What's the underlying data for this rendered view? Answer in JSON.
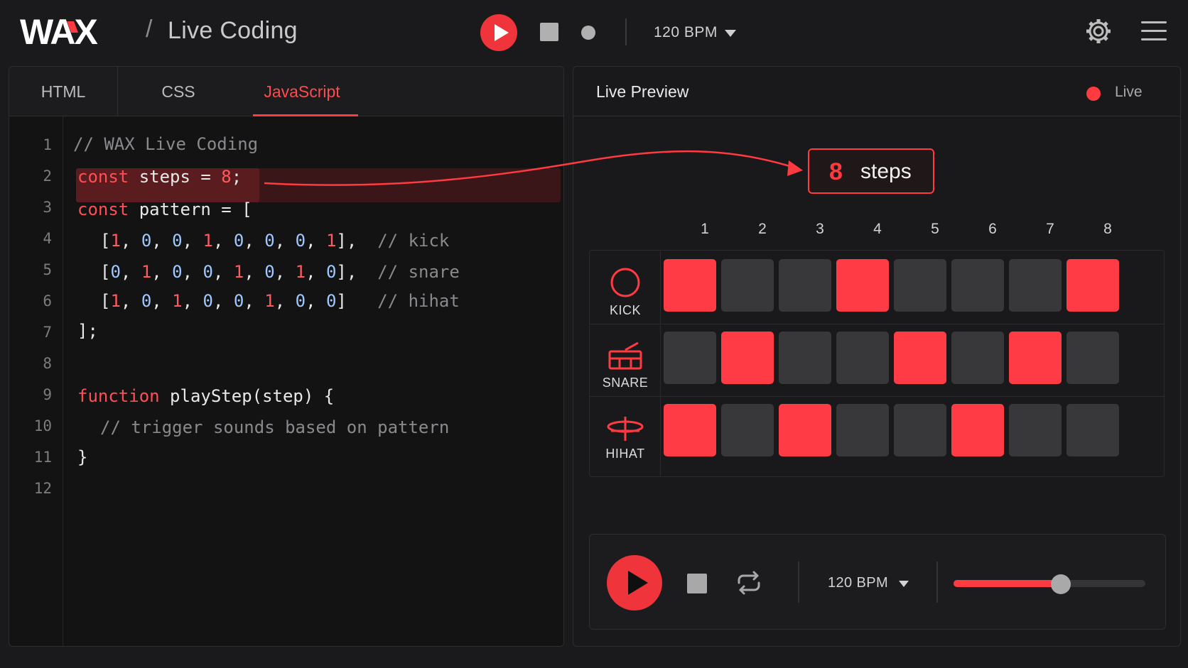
{
  "app": {
    "logo_text": "WAX",
    "separator": "/",
    "title": "Live Coding"
  },
  "toolbar": {
    "bpm": "120 BPM"
  },
  "editor": {
    "tabs": [
      {
        "label": "HTML",
        "active": false
      },
      {
        "label": "CSS",
        "active": false
      },
      {
        "label": "JavaScript",
        "active": true
      }
    ],
    "line_numbers": [
      "1",
      "2",
      "3",
      "4",
      "5",
      "6",
      "7",
      "8",
      "9",
      "10",
      "11",
      "12"
    ],
    "highlighted_line": 2,
    "lines": {
      "l1": "// WAX Live Coding",
      "l2_kw": "const",
      "l2_rest": " steps = ",
      "l2_num": "8",
      "l2_end": ";",
      "l3_kw": "const",
      "l3_rest": " pattern = [",
      "l4_comment": "// kick",
      "l5_comment": "// snare",
      "l6_comment": "// hihat",
      "l7": "];",
      "l9_kw": "function",
      "l9_rest": " playStep(step) {",
      "l10": "// trigger sounds based on pattern",
      "l11": "}"
    }
  },
  "preview": {
    "title": "Live Preview",
    "live_label": "Live",
    "steps_badge": {
      "value": "8",
      "label": "steps"
    },
    "columns": [
      "1",
      "2",
      "3",
      "4",
      "5",
      "6",
      "7",
      "8"
    ],
    "instruments": [
      {
        "name": "KICK",
        "icon": "kick-drum-icon",
        "pattern": [
          1,
          0,
          0,
          1,
          0,
          0,
          0,
          1
        ]
      },
      {
        "name": "SNARE",
        "icon": "snare-drum-icon",
        "pattern": [
          0,
          1,
          0,
          0,
          1,
          0,
          1,
          0
        ]
      },
      {
        "name": "HIHAT",
        "icon": "hihat-cymbal-icon",
        "pattern": [
          1,
          0,
          1,
          0,
          0,
          1,
          0,
          0
        ]
      }
    ],
    "transport": {
      "bpm": "120 BPM",
      "volume": 0.56
    }
  },
  "colors": {
    "accent": "#ff3b41",
    "step_on": "#ff3b45",
    "step_off": "#38383b",
    "background": "#1a1a1c"
  }
}
